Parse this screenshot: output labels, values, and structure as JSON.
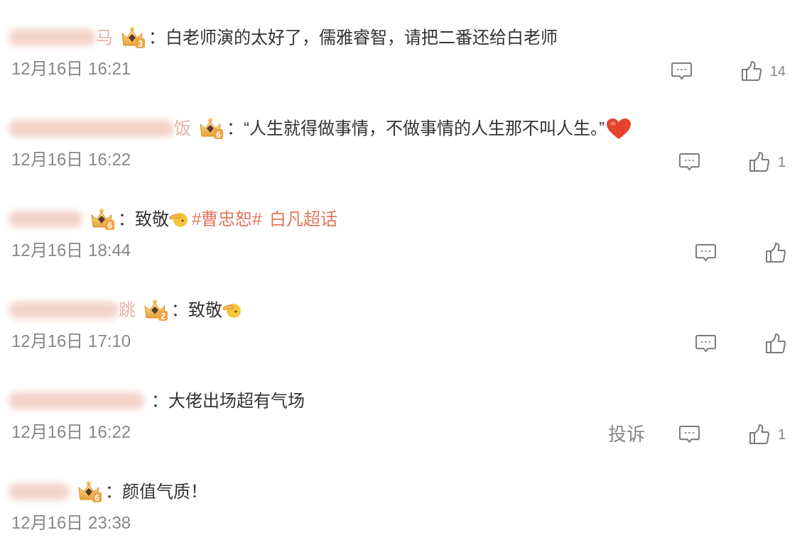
{
  "comments": [
    {
      "name_visible": "马",
      "badge": {
        "level": "3"
      },
      "separator": "：",
      "content": [
        {
          "kind": "text",
          "text": "白老师演的太好了，儒雅睿智，请把二番还给白老师"
        }
      ],
      "time": "12月16日 16:21",
      "actions_shown": true,
      "like_count": "14"
    },
    {
      "name_visible": "饭",
      "badge": {
        "level": "6"
      },
      "separator": "：",
      "content": [
        {
          "kind": "text",
          "text": "“人生就得做事情，不做事情的人生那不叫人生。”"
        },
        {
          "kind": "heart"
        }
      ],
      "time": "12月16日 16:22",
      "actions_shown": true,
      "like_count": "1"
    },
    {
      "badge": {
        "level": "6"
      },
      "separator": "：",
      "content": [
        {
          "kind": "text",
          "text": "致敬"
        },
        {
          "kind": "salute"
        },
        {
          "kind": "topic",
          "text": "#曹忠恕#"
        },
        {
          "kind": "topic",
          "text": "白凡超话"
        }
      ],
      "time": "12月16日 18:44",
      "actions_shown": true
    },
    {
      "name_visible": "跳",
      "badge": {
        "level": "2"
      },
      "separator": "：",
      "content": [
        {
          "kind": "text",
          "text": "致敬"
        },
        {
          "kind": "salute"
        }
      ],
      "time": "12月16日 17:10",
      "actions_shown": true
    },
    {
      "separator": "：",
      "content": [
        {
          "kind": "text",
          "text": "大佬出场超有气场"
        }
      ],
      "time": "12月16日 16:22",
      "actions_shown": true,
      "report": "投诉",
      "like_count": "1"
    },
    {
      "badge": {
        "level": "6"
      },
      "separator": "：",
      "content": [
        {
          "kind": "text",
          "text": "颜值气质！"
        }
      ],
      "time": "12月16日 23:38",
      "actions_shown": false
    }
  ]
}
